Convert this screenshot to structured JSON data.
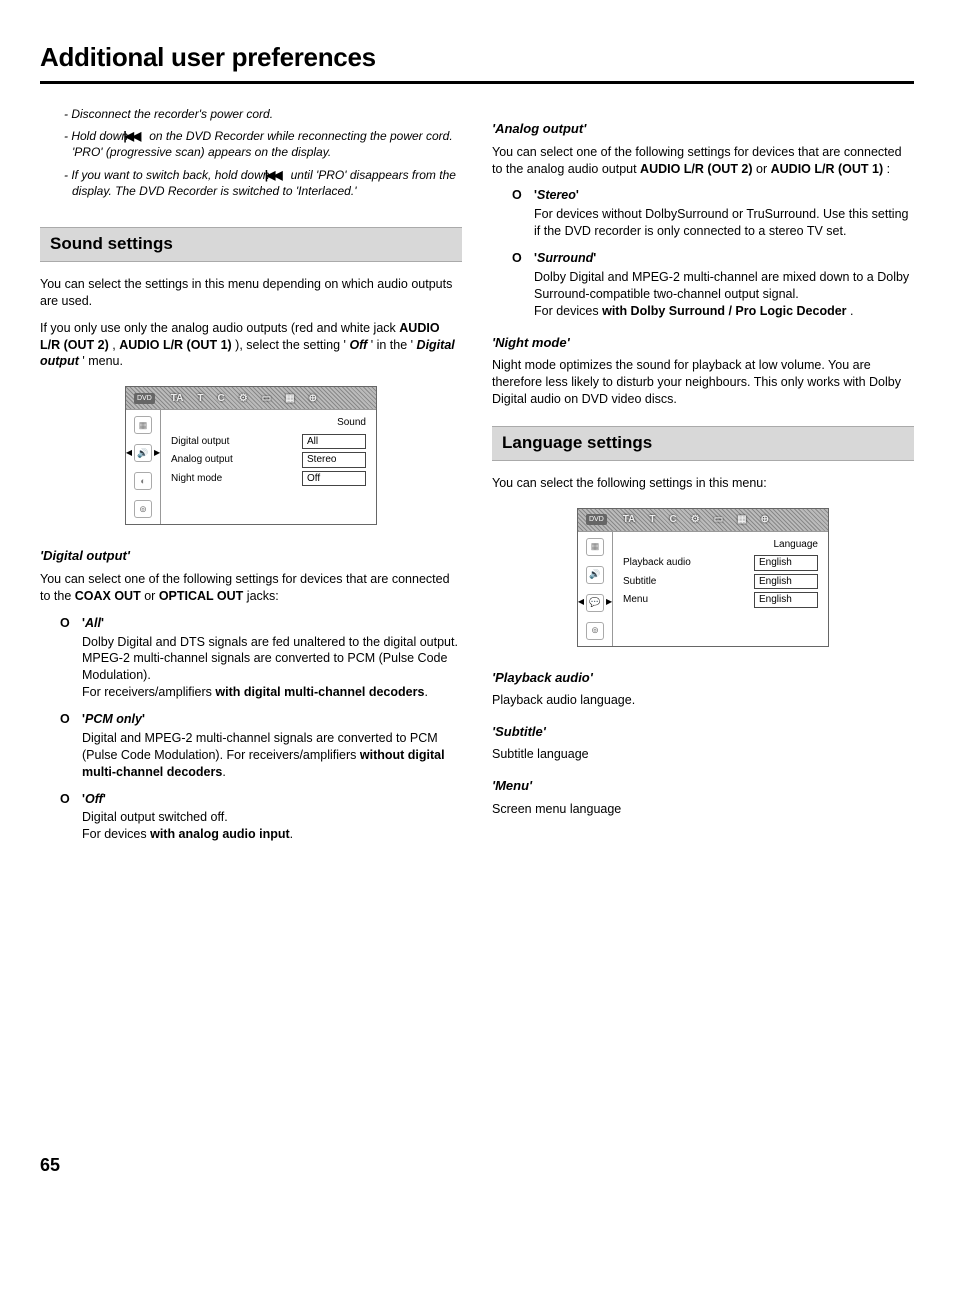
{
  "pageTitle": "Additional user preferences",
  "pageNumber": "65",
  "intro": {
    "line1_pre": "- Disconnect the recorder's power cord.",
    "line2_pre": "- Hold down ",
    "line2_post": " on the DVD Recorder while reconnecting the power cord. 'PRO' (progressive scan) appears on the display.",
    "line3_pre": "- If you want to switch back, hold down ",
    "line3_post": " until 'PRO' disappears from the display. The DVD Recorder is switched to 'Interlaced.'",
    "rewind_glyph": "|◀◀"
  },
  "soundSection": {
    "heading": "Sound settings",
    "para1": "You can select the settings in this menu depending on which audio outputs are used.",
    "para2_pre": "If you only use only the analog audio outputs (red and white jack ",
    "para2_b1": "AUDIO L/R (OUT 2)",
    "para2_mid1": " , ",
    "para2_b2": "AUDIO L/R (OUT 1)",
    "para2_mid2": " ), select the setting '",
    "para2_b3": "Off",
    "para2_mid3": "' in the '",
    "para2_b4": "Digital output",
    "para2_post": "' menu.",
    "screenshot": {
      "headerLabel": "Sound",
      "tabs": [
        "TA",
        "T",
        "C",
        "",
        "",
        "",
        ""
      ],
      "rows": [
        {
          "label": "Digital output",
          "value": "All"
        },
        {
          "label": "Analog output",
          "value": "Stereo"
        },
        {
          "label": "Night mode",
          "value": "Off"
        }
      ]
    },
    "digitalOutput": {
      "head": "Digital output",
      "intro_pre": "You can select one of the following settings for devices that are connected to the ",
      "intro_b1": "COAX OUT",
      "intro_mid": " or ",
      "intro_b2": "OPTICAL OUT",
      "intro_post": " jacks:",
      "options": [
        {
          "name": "All",
          "desc_pre": "Dolby Digital and DTS signals are fed unaltered to the digital output. MPEG-2 multi-channel signals are converted to PCM (Pulse Code Modulation).",
          "desc_for": "For receivers/amplifiers ",
          "desc_bold": "with digital multi-channel decoders",
          "desc_post": "."
        },
        {
          "name": "PCM only",
          "desc_pre": "Digital and MPEG-2 multi-channel signals are converted to PCM (Pulse Code Modulation). For receivers/amplifiers ",
          "desc_for": "",
          "desc_bold": "without digital multi-channel decoders",
          "desc_post": "."
        },
        {
          "name": "Off",
          "desc_pre": "Digital output switched off.",
          "desc_for": "For devices ",
          "desc_bold": "with analog audio input",
          "desc_post": "."
        }
      ]
    }
  },
  "analogOutput": {
    "head": "Analog output",
    "intro_pre": "You can select one of the following settings for devices that are connected to the analog audio output ",
    "intro_b1": "AUDIO L/R (OUT 2)",
    "intro_mid": " or ",
    "intro_b2": "AUDIO L/R (OUT 1)",
    "intro_post": " :",
    "options": [
      {
        "name": "Stereo",
        "desc_pre": "For devices without DolbySurround or TruSurround. Use this setting if the DVD recorder is only connected to a stereo TV set.",
        "desc_for": "",
        "desc_bold": "",
        "desc_post": ""
      },
      {
        "name": "Surround",
        "desc_pre": "Dolby Digital and MPEG-2 multi-channel are mixed down to a Dolby Surround-compatible two-channel output signal.",
        "desc_for": "For devices ",
        "desc_bold": "with Dolby Surround / Pro Logic Decoder",
        "desc_post": " ."
      }
    ]
  },
  "nightMode": {
    "head": "Night mode",
    "desc": "Night mode optimizes the sound for playback at low volume. You are therefore less likely to disturb your neighbours. This only works with Dolby Digital audio on DVD video discs."
  },
  "languageSection": {
    "heading": "Language settings",
    "intro": "You can select the following settings in this menu:",
    "screenshot": {
      "headerLabel": "Language",
      "tabs": [
        "TA",
        "T",
        "C",
        "",
        "",
        "",
        ""
      ],
      "rows": [
        {
          "label": "Playback audio",
          "value": "English"
        },
        {
          "label": "Subtitle",
          "value": "English"
        },
        {
          "label": "Menu",
          "value": "English"
        }
      ]
    },
    "playback": {
      "head": "Playback audio",
      "desc": "Playback audio language."
    },
    "subtitle": {
      "head": "Subtitle",
      "desc": "Subtitle language"
    },
    "menu": {
      "head": "Menu",
      "desc": "Screen menu language"
    }
  }
}
